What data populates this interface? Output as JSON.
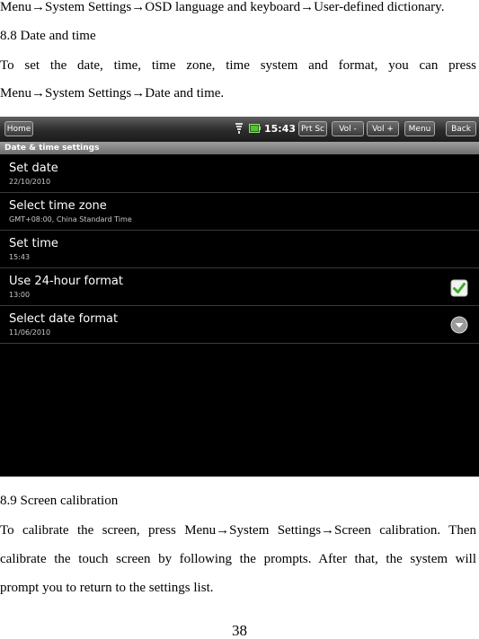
{
  "doc": {
    "line1": "Menu→System Settings→OSD language and keyboard→User-defined dictionary.",
    "heading_88": "8.8 Date and time",
    "para_88_line1": "To set the date, time, time zone, time system and format, you can press",
    "para_88_line2": "Menu→System Settings→Date and time.",
    "heading_89": "8.9 Screen calibration",
    "para_89_line1": "To calibrate the screen, press Menu→System Settings→Screen calibration. Then",
    "para_89_line2": "calibrate the touch screen by following the prompts. After that, the system will",
    "para_89_line3": "prompt you to return to the settings list.",
    "page_number": "38"
  },
  "screen": {
    "statusbar": {
      "home_label": "Home",
      "clock": "15:43",
      "prtsc_label": "Prt Sc",
      "vol_down_label": "Vol -",
      "vol_up_label": "Vol +",
      "menu_label": "Menu",
      "back_label": "Back"
    },
    "title": "Date & time settings",
    "items": [
      {
        "title": "Set date",
        "subtitle": "22/10/2010"
      },
      {
        "title": "Select time zone",
        "subtitle": "GMT+08:00, China Standard Time"
      },
      {
        "title": "Set time",
        "subtitle": "15:43"
      },
      {
        "title": "Use 24-hour format",
        "subtitle": "13:00",
        "checked": true
      },
      {
        "title": "Select date format",
        "subtitle": "11/06/2010"
      }
    ],
    "colors": {
      "check_green": "#3fae29",
      "background": "#000000"
    }
  }
}
